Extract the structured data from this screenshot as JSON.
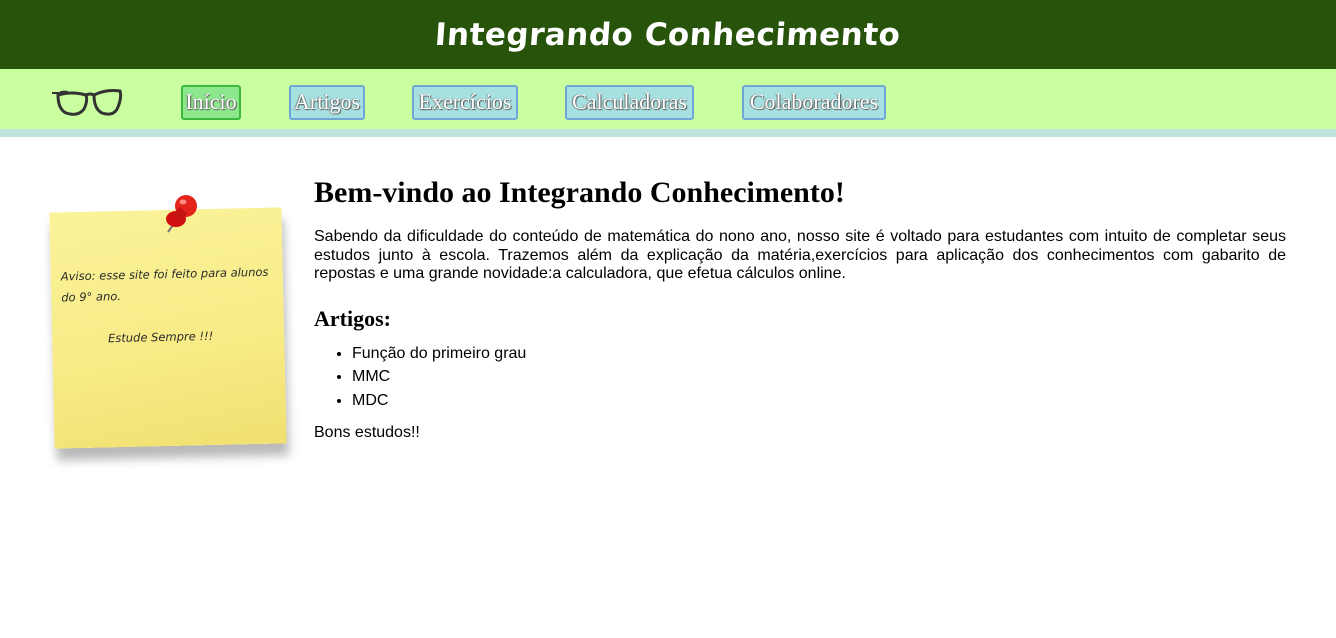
{
  "header": {
    "title": "Integrando Conhecimento"
  },
  "nav": {
    "logo_icon": "glasses-icon",
    "items": [
      {
        "label": "Início",
        "active": true
      },
      {
        "label": "Artigos"
      },
      {
        "label": "Exercícios"
      },
      {
        "label": "Calculadoras"
      },
      {
        "label": "Colaboradores"
      }
    ]
  },
  "note": {
    "text": "Aviso: esse site foi feito para alunos do 9° ano.",
    "sub": "Estude Sempre !!!"
  },
  "main": {
    "heading": "Bem-vindo ao Integrando Conhecimento!",
    "intro": "Sabendo da dificuldade do conteúdo de matemática do nono ano, nosso site é voltado para estudantes com intuito de completar seus estudos junto à escola. Trazemos além da explicação da matéria,exercícios para aplicação dos conhecimentos com gabarito de repostas e uma grande novidade:a calculadora, que efetua cálculos online.",
    "articles_heading": "Artigos:",
    "articles": [
      "Função do primeiro grau",
      "MMC",
      "MDC"
    ],
    "closing": "Bons estudos!!"
  },
  "colors": {
    "header_bg": "#27530b",
    "nav_bg": "#caffa0",
    "nav_button_bg": "#a7e0e0",
    "nav_active_bg": "#8de88d"
  }
}
